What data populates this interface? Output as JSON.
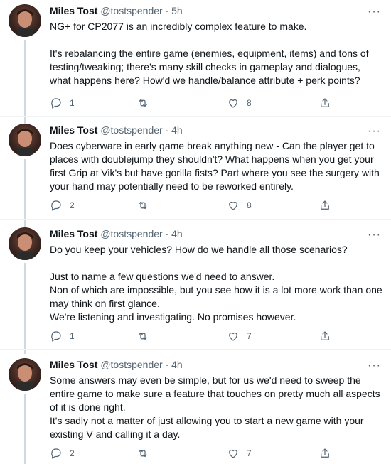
{
  "tweets": [
    {
      "name": "Miles Tost",
      "handle": "@tostspender",
      "time": "5h",
      "text": "NG+ for CP2077 is an incredibly complex feature to make.\n\nIt's rebalancing the entire game (enemies, equipment, items) and tons of testing/tweaking; there's many skill checks in gameplay and dialogues, what happens here? How'd we handle/balance attribute + perk points?",
      "replies": "1",
      "retweets": "",
      "likes": "8"
    },
    {
      "name": "Miles Tost",
      "handle": "@tostspender",
      "time": "4h",
      "text": "Does cyberware in early game break anything new - Can the player get to places with doublejump they shouldn't? What happens when you get your first Grip at Vik's but have gorilla fists? Part where you see the surgery with your hand may potentially need to be reworked entirely.",
      "replies": "2",
      "retweets": "",
      "likes": "8"
    },
    {
      "name": "Miles Tost",
      "handle": "@tostspender",
      "time": "4h",
      "text": "Do you keep your vehicles? How do we handle all those scenarios?\n\nJust to name a few questions we'd need to answer.\nNon of which are impossible, but you see how it is a lot more work than one may think on first glance.\nWe're listening and investigating. No promises however.",
      "replies": "1",
      "retweets": "",
      "likes": "7"
    },
    {
      "name": "Miles Tost",
      "handle": "@tostspender",
      "time": "4h",
      "text": "Some answers may even be simple, but for us we'd need to sweep the entire game to make sure a feature that touches on pretty much all aspects of it is done right.\nIt's sadly not a matter of just allowing you to start a new game with your existing V and calling it a day.",
      "replies": "2",
      "retweets": "",
      "likes": "7"
    }
  ],
  "separator": "·",
  "more_glyph": "···",
  "colors": {
    "text": "#0f1419",
    "secondary": "#536471",
    "thread_line": "#cfd9de"
  },
  "icons": [
    "reply-icon",
    "retweet-icon",
    "like-icon",
    "share-icon",
    "more-icon"
  ]
}
